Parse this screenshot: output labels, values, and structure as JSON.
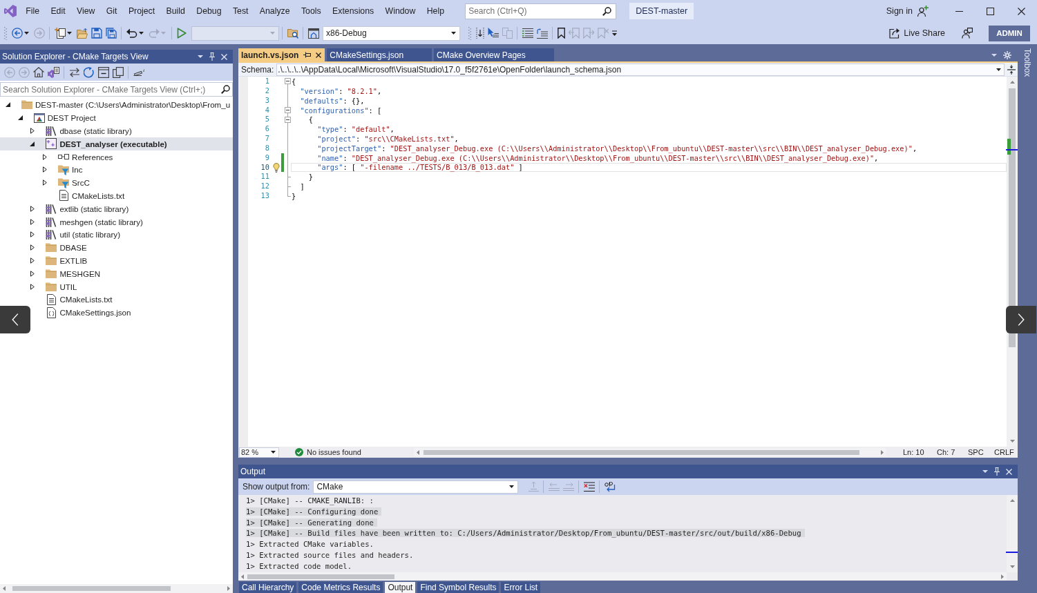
{
  "menu": [
    "File",
    "Edit",
    "View",
    "Git",
    "Project",
    "Build",
    "Debug",
    "Test",
    "Analyze",
    "Tools",
    "Extensions",
    "Window",
    "Help"
  ],
  "search": {
    "placeholder": "Search (Ctrl+Q)"
  },
  "solution_name": "DEST-master",
  "sign_in": "Sign in",
  "configuration": "x86-Debug",
  "live_share": "Live Share",
  "account": "ADMIN",
  "solution_explorer": {
    "title": "Solution Explorer - CMake Targets View",
    "search": {
      "placeholder": "Search Solution Explorer - CMake Targets View (Ctrl+;)"
    },
    "tree": [
      {
        "label": "DEST-master (C:\\Users\\Administrator\\Desktop\\From_u",
        "kind": "folder",
        "expanded": true,
        "selected": false,
        "startup": false,
        "children": [
          {
            "label": "DEST Project",
            "kind": "project",
            "expanded": true,
            "selected": false,
            "startup": false,
            "children": [
              {
                "label": "dbase (static library)",
                "kind": "library",
                "expanded": false,
                "selected": false,
                "startup": false
              },
              {
                "label": "DEST_analyser (executable)",
                "kind": "executable",
                "expanded": true,
                "selected": true,
                "startup": true,
                "children": [
                  {
                    "label": "References",
                    "kind": "references",
                    "expanded": false,
                    "selected": false,
                    "startup": false
                  },
                  {
                    "label": "Inc",
                    "kind": "filter",
                    "expanded": false,
                    "selected": false,
                    "startup": false
                  },
                  {
                    "label": "SrcC",
                    "kind": "filter",
                    "expanded": false,
                    "selected": false,
                    "startup": false
                  },
                  {
                    "label": "CMakeLists.txt",
                    "kind": "file",
                    "selected": false,
                    "startup": false
                  }
                ]
              },
              {
                "label": "extlib (static library)",
                "kind": "library",
                "expanded": false,
                "selected": false,
                "startup": false
              },
              {
                "label": "meshgen (static library)",
                "kind": "library",
                "expanded": false,
                "selected": false,
                "startup": false
              },
              {
                "label": "util (static library)",
                "kind": "library",
                "expanded": false,
                "selected": false,
                "startup": false
              },
              {
                "label": "DBASE",
                "kind": "folder",
                "expanded": false,
                "selected": false,
                "startup": false
              },
              {
                "label": "EXTLIB",
                "kind": "folder",
                "expanded": false,
                "selected": false,
                "startup": false
              },
              {
                "label": "MESHGEN",
                "kind": "folder",
                "expanded": false,
                "selected": false,
                "startup": false
              },
              {
                "label": "UTIL",
                "kind": "folder",
                "expanded": false,
                "selected": false,
                "startup": false
              },
              {
                "label": "CMakeLists.txt",
                "kind": "file",
                "selected": false,
                "startup": false
              },
              {
                "label": "CMakeSettings.json",
                "kind": "json",
                "selected": false,
                "startup": false
              }
            ]
          }
        ]
      }
    ]
  },
  "editor": {
    "tabs": [
      {
        "label": "launch.vs.json",
        "selected": true
      },
      {
        "label": "CMakeSettings.json",
        "selected": false
      },
      {
        "label": "CMake Overview Pages",
        "selected": false
      }
    ],
    "schema_label": "Schema:",
    "schema": ".\\..\\..\\..\\AppData\\Local\\Microsoft\\VisualStudio\\17.0_f5f2761e\\OpenFolder\\launch_schema.json",
    "lines": [
      {
        "number": "1",
        "kind": "block_start",
        "changed": false,
        "current": false,
        "parts": [
          {
            "kind": "punct",
            "text": "{"
          }
        ]
      },
      {
        "number": "2",
        "kind": "plain",
        "changed": false,
        "current": false,
        "parts": [
          {
            "kind": "key",
            "text": "\"version\""
          },
          {
            "kind": "punct",
            "text": ": "
          },
          {
            "kind": "string",
            "text": "\"8.2.1\""
          },
          {
            "kind": "punct",
            "text": ","
          }
        ]
      },
      {
        "number": "3",
        "kind": "plain",
        "changed": false,
        "current": false,
        "parts": [
          {
            "kind": "key",
            "text": "\"defaults\""
          },
          {
            "kind": "punct",
            "text": ": {},"
          }
        ]
      },
      {
        "number": "4",
        "kind": "block_start",
        "changed": false,
        "current": false,
        "parts": [
          {
            "kind": "key",
            "text": "\"configurations\""
          },
          {
            "kind": "punct",
            "text": ": ["
          }
        ]
      },
      {
        "number": "5",
        "kind": "block_start",
        "changed": false,
        "current": false,
        "parts": [
          {
            "kind": "punct",
            "text": "{"
          }
        ]
      },
      {
        "number": "6",
        "kind": "plain",
        "changed": false,
        "current": false,
        "parts": [
          {
            "kind": "key",
            "text": "\"type\""
          },
          {
            "kind": "punct",
            "text": ": "
          },
          {
            "kind": "string",
            "text": "\"default\""
          },
          {
            "kind": "punct",
            "text": ","
          }
        ]
      },
      {
        "number": "7",
        "kind": "plain",
        "changed": false,
        "current": false,
        "parts": [
          {
            "kind": "key",
            "text": "\"project\""
          },
          {
            "kind": "punct",
            "text": ": "
          },
          {
            "kind": "string",
            "text": "\"src\\\\CMakeLists.txt\""
          },
          {
            "kind": "punct",
            "text": ","
          }
        ]
      },
      {
        "number": "8",
        "kind": "plain",
        "changed": false,
        "current": false,
        "parts": [
          {
            "kind": "key",
            "text": "\"projectTarget\""
          },
          {
            "kind": "punct",
            "text": ": "
          },
          {
            "kind": "string",
            "text": "\"DEST_analyser_Debug.exe (C:\\\\Users\\\\Administrator\\\\Desktop\\\\From_ubuntu\\\\DEST-master\\\\src\\\\BIN\\\\DEST_analyser_Debug.exe)\""
          },
          {
            "kind": "punct",
            "text": ","
          }
        ]
      },
      {
        "number": "9",
        "kind": "plain",
        "changed": true,
        "current": false,
        "parts": [
          {
            "kind": "key",
            "text": "\"name\""
          },
          {
            "kind": "punct",
            "text": ": "
          },
          {
            "kind": "string",
            "text": "\"DEST_analyser_Debug.exe (C:\\\\Users\\\\Administrator\\\\Desktop\\\\From_ubuntu\\\\DEST-master\\\\src\\\\BIN\\\\DEST_analyser_Debug.exe)\""
          },
          {
            "kind": "punct",
            "text": ","
          }
        ]
      },
      {
        "number": "10",
        "kind": "plain",
        "changed": true,
        "current": true,
        "parts": [
          {
            "kind": "key",
            "text": "\"args\""
          },
          {
            "kind": "punct",
            "text": ": [ "
          },
          {
            "kind": "string",
            "text": "\"-filename ../TESTS/B_013/B_013.dat\""
          },
          {
            "kind": "punct",
            "text": " ]"
          }
        ]
      },
      {
        "number": "11",
        "kind": "block_end",
        "changed": false,
        "current": false,
        "parts": [
          {
            "kind": "punct",
            "text": "}"
          }
        ]
      },
      {
        "number": "12",
        "kind": "block_end",
        "changed": false,
        "current": false,
        "parts": [
          {
            "kind": "punct",
            "text": "]"
          }
        ]
      },
      {
        "number": "13",
        "kind": "block_end",
        "changed": false,
        "current": false,
        "parts": [
          {
            "kind": "punct",
            "text": "}"
          }
        ]
      }
    ],
    "zoom": "82 %",
    "issues": "No issues found",
    "line": "Ln: 10",
    "column": "Ch: 7",
    "indentation": "SPC",
    "line_ending": "CRLF"
  },
  "output": {
    "title": "Output",
    "source_label": "Show output from:",
    "source": "CMake",
    "lines": [
      {
        "text": "1> [CMake] -- CMAKE_RANLIB: :",
        "selected": false
      },
      {
        "text": "1> [CMake] -- Configuring done",
        "selected": true
      },
      {
        "text": "1> [CMake] -- Generating done",
        "selected": true
      },
      {
        "text": "1> [CMake] -- Build files have been written to: C:/Users/Administrator/Desktop/From_ubuntu/DEST-master/src/out/build/x86-Debug",
        "selected": true
      },
      {
        "text": "1> Extracted CMake variables.",
        "selected": false
      },
      {
        "text": "1> Extracted source files and headers.",
        "selected": false
      },
      {
        "text": "1> Extracted code model.",
        "selected": false
      }
    ]
  },
  "bottom_tabs": [
    {
      "label": "Call Hierarchy",
      "selected": false
    },
    {
      "label": "Code Metrics Results",
      "selected": false
    },
    {
      "label": "Output",
      "selected": true
    },
    {
      "label": "Find Symbol Results",
      "selected": false
    },
    {
      "label": "Error List",
      "selected": false
    }
  ],
  "toolbox": "Toolbox"
}
